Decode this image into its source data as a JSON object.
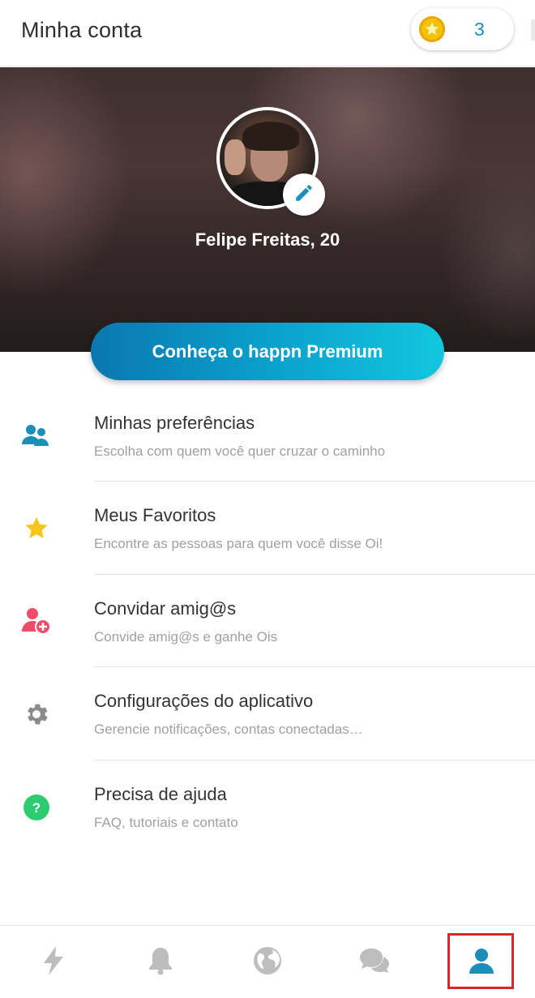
{
  "header": {
    "title": "Minha conta",
    "coins": "3",
    "coin_icon": "gold-coin-star-icon"
  },
  "profile": {
    "name": "Felipe Freitas, 20",
    "edit_icon": "pencil-icon"
  },
  "premium": {
    "label": "Conheça o happn Premium"
  },
  "menu": [
    {
      "title": "Minhas preferências",
      "subtitle": "Escolha com quem você quer cruzar o caminho",
      "icon": "people-icon",
      "color": "#1b8fb7"
    },
    {
      "title": "Meus Favoritos",
      "subtitle": "Encontre as pessoas para quem você disse Oi!",
      "icon": "star-icon",
      "color": "#f5c518"
    },
    {
      "title": "Convidar amig@s",
      "subtitle": "Convide amig@s e ganhe Ois",
      "icon": "add-person-icon",
      "color": "#ee4d6a"
    },
    {
      "title": "Configurações do aplicativo",
      "subtitle": "Gerencie notificações, contas conectadas…",
      "icon": "gear-icon",
      "color": "#8a8a8a"
    },
    {
      "title": "Precisa de ajuda",
      "subtitle": "FAQ, tutoriais e contato",
      "icon": "help-icon",
      "color": "#2ecc71"
    }
  ],
  "bottom_nav": [
    {
      "name": "timeline",
      "icon": "lightning-icon",
      "active": false
    },
    {
      "name": "notifications",
      "icon": "bell-icon",
      "active": false
    },
    {
      "name": "map",
      "icon": "globe-icon",
      "active": false
    },
    {
      "name": "chat",
      "icon": "chat-bubbles-icon",
      "active": false
    },
    {
      "name": "profile",
      "icon": "person-icon",
      "active": true
    }
  ],
  "colors": {
    "accent": "#1b8fb7",
    "inactive_icon": "#bdbdbd",
    "highlight_box": "#d9262c"
  }
}
